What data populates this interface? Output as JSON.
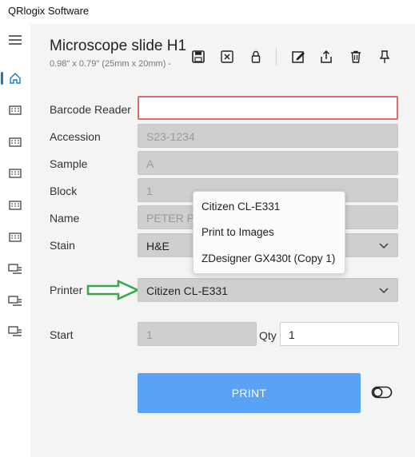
{
  "app": {
    "title": "QRlogix Software"
  },
  "header": {
    "title": "Microscope slide H1",
    "subtitle": "0.98\" x 0.79\" (25mm x 20mm) -"
  },
  "toolbar": {
    "icons": [
      "save-icon",
      "close-box-icon",
      "lock-icon",
      "edit-icon",
      "share-icon",
      "delete-icon",
      "pin-icon"
    ]
  },
  "sidebar": {
    "icons": [
      "menu-icon",
      "home-icon",
      "label-icon",
      "label-icon",
      "label-icon",
      "label-icon",
      "label-icon",
      "label-list-icon",
      "label-list-icon",
      "label-list-icon"
    ],
    "active_color": "#1976d2"
  },
  "form": {
    "barcode": {
      "label": "Barcode Reader",
      "value": ""
    },
    "accession": {
      "label": "Accession",
      "value": "S23-1234"
    },
    "sample": {
      "label": "Sample",
      "value": "A"
    },
    "block": {
      "label": "Block",
      "value": "1"
    },
    "name": {
      "label": "Name",
      "value": "PETER PA"
    },
    "stain": {
      "label": "Stain",
      "value": "H&E"
    },
    "printer": {
      "label": "Printer",
      "value": "Citizen CL-E331"
    },
    "start": {
      "label": "Start",
      "value": "1"
    },
    "qty": {
      "label": "Qty",
      "value": "1"
    }
  },
  "printer_dropdown": {
    "options": [
      "Citizen CL-E331",
      "Print to Images",
      "ZDesigner GX430t (Copy 1)"
    ]
  },
  "print_button": {
    "label": "PRINT",
    "color": "#5aa2f5"
  },
  "annotation": {
    "arrow_color": "#3aa84a"
  }
}
